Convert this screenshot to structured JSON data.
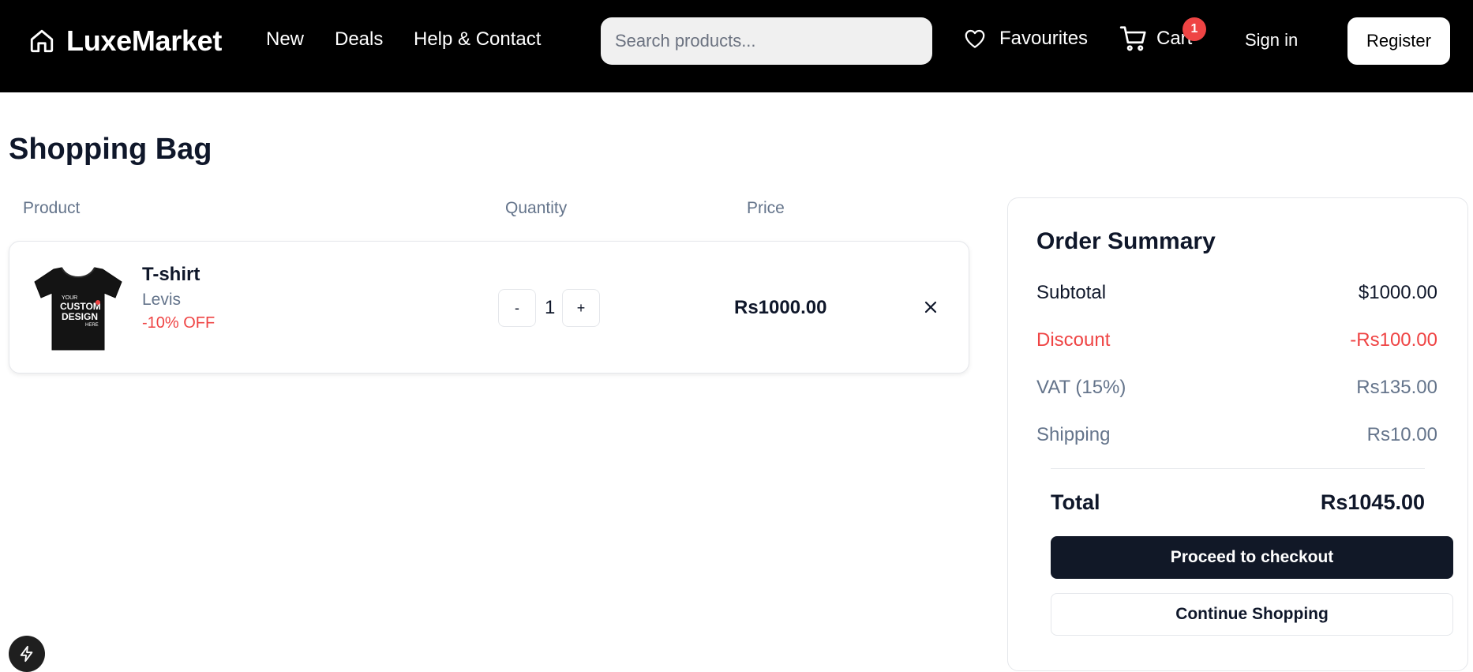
{
  "header": {
    "brand": "LuxeMarket",
    "nav": [
      "New",
      "Deals",
      "Help & Contact"
    ],
    "search_placeholder": "Search products...",
    "favourites_label": "Favourites",
    "cart_label": "Cart",
    "cart_count": "1",
    "signin_label": "Sign in",
    "register_label": "Register"
  },
  "page": {
    "title": "Shopping Bag",
    "columns": {
      "product": "Product",
      "quantity": "Quantity",
      "price": "Price"
    }
  },
  "cart_item": {
    "name": "T-shirt",
    "brand": "Levis",
    "discount": "-10% OFF",
    "quantity": "1",
    "decrement_label": "-",
    "increment_label": "+",
    "price": "Rs1000.00",
    "image_text": {
      "top": "YOUR",
      "line1": "CUSTOM",
      "line2": "DESIGN",
      "bottom": "HERE"
    }
  },
  "summary": {
    "title": "Order Summary",
    "subtotal_label": "Subtotal",
    "subtotal_value": "$1000.00",
    "discount_label": "Discount",
    "discount_value": "-Rs100.00",
    "vat_label": "VAT (15%)",
    "vat_value": "Rs135.00",
    "shipping_label": "Shipping",
    "shipping_value": "Rs10.00",
    "total_label": "Total",
    "total_value": "Rs1045.00",
    "checkout_label": "Proceed to checkout",
    "continue_label": "Continue Shopping"
  },
  "colors": {
    "header_bg": "#000000",
    "accent_red": "#ef4444",
    "checkout_bg": "#111827",
    "muted_text": "#64748b"
  },
  "icons": [
    "home-icon",
    "heart-icon",
    "cart-icon",
    "close-icon",
    "bolt-icon"
  ]
}
